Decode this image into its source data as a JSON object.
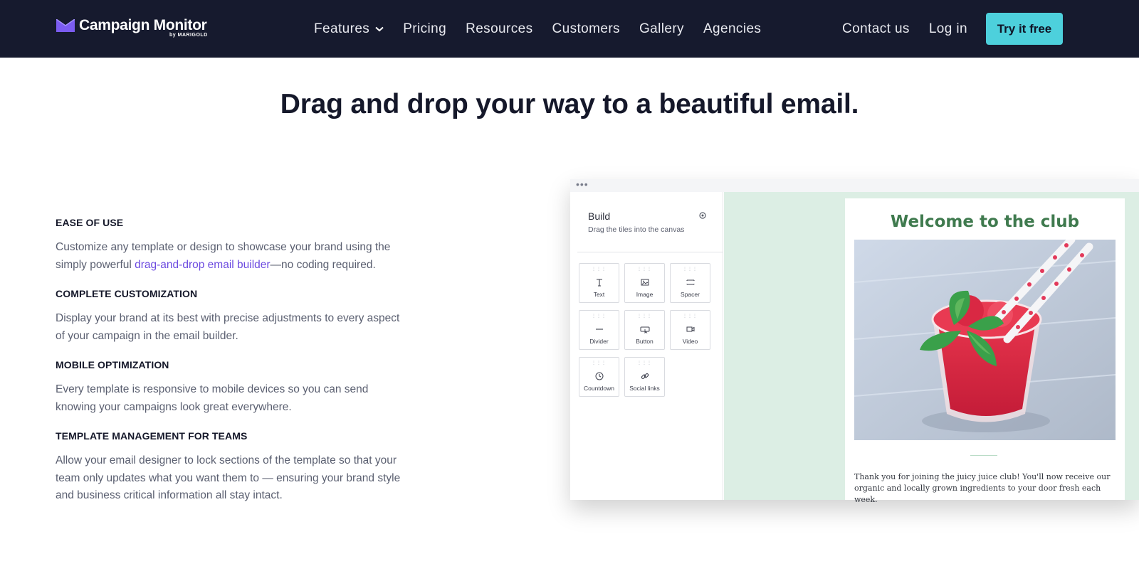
{
  "brand": {
    "name": "Campaign Monitor",
    "byline": "by MARIGOLD",
    "accent": "#4dd0dc",
    "nav_bg": "#161a2e",
    "link_color": "#6c4be0"
  },
  "nav": {
    "items": [
      {
        "label": "Features",
        "has_dropdown": true
      },
      {
        "label": "Pricing"
      },
      {
        "label": "Resources"
      },
      {
        "label": "Customers"
      },
      {
        "label": "Gallery"
      },
      {
        "label": "Agencies"
      }
    ],
    "contact": "Contact us",
    "login": "Log in",
    "cta": "Try it free"
  },
  "headline": "Drag and drop your way to a beautiful email.",
  "features": [
    {
      "title": "EASE OF USE",
      "text_before": "Customize any template or design to showcase your brand using the simply powerful ",
      "link": "drag-and-drop email builder",
      "text_after": "—no coding required."
    },
    {
      "title": "COMPLETE CUSTOMIZATION",
      "text": "Display your brand at its best with precise adjustments to every aspect of your campaign in the email builder."
    },
    {
      "title": "MOBILE OPTIMIZATION",
      "text": "Every template is responsive to mobile devices so you can send knowing your campaigns look great everywhere."
    },
    {
      "title": "TEMPLATE MANAGEMENT FOR TEAMS",
      "text": "Allow your email designer to lock sections of the template so that your team only updates what you want them to — ensuring your brand style and business critical information all stay intact."
    }
  ],
  "builder": {
    "window_dots": "•••",
    "title": "Build",
    "subtitle": "Drag the tiles into the canvas",
    "settings_icon": "gear-icon",
    "tiles": [
      {
        "label": "Text",
        "icon": "text-icon"
      },
      {
        "label": "Image",
        "icon": "image-icon"
      },
      {
        "label": "Spacer",
        "icon": "spacer-icon"
      },
      {
        "label": "Divider",
        "icon": "divider-icon"
      },
      {
        "label": "Button",
        "icon": "button-icon"
      },
      {
        "label": "Video",
        "icon": "video-icon"
      },
      {
        "label": "Countdown",
        "icon": "countdown-icon"
      },
      {
        "label": "Social links",
        "icon": "link-icon"
      }
    ],
    "canvas_bg": "#dceee4"
  },
  "email_preview": {
    "title": "Welcome to the club",
    "title_color": "#3f7a4e",
    "body": "Thank you for joining the juicy juice club! You'll now receive our organic and locally grown ingredients to your door fresh each week."
  }
}
